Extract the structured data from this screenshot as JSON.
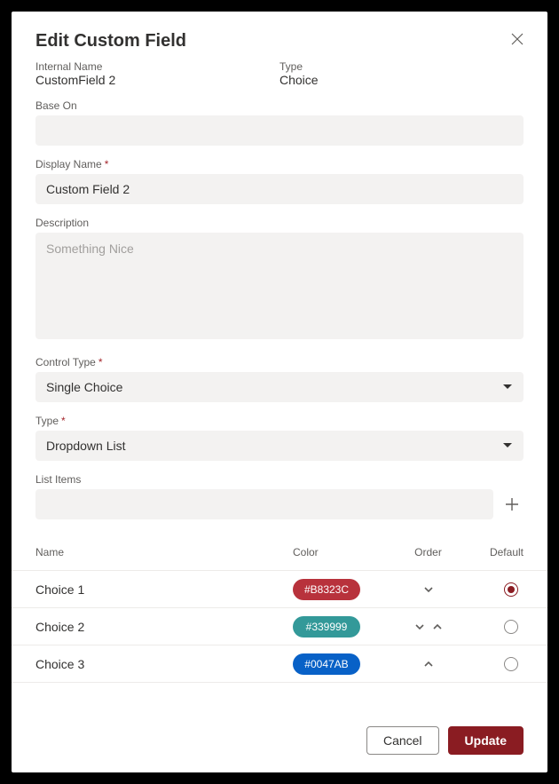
{
  "dialog": {
    "title": "Edit Custom Field"
  },
  "info": {
    "internalName": {
      "label": "Internal Name",
      "value": "CustomField 2"
    },
    "type": {
      "label": "Type",
      "value": "Choice"
    }
  },
  "fields": {
    "baseOn": {
      "label": "Base On",
      "value": ""
    },
    "displayName": {
      "label": "Display Name",
      "value": "Custom Field 2"
    },
    "description": {
      "label": "Description",
      "placeholder": "Something Nice",
      "value": ""
    },
    "controlType": {
      "label": "Control Type",
      "value": "Single Choice"
    },
    "listType": {
      "label": "Type",
      "value": "Dropdown List"
    },
    "listItems": {
      "label": "List Items",
      "value": ""
    }
  },
  "table": {
    "headers": {
      "name": "Name",
      "color": "Color",
      "order": "Order",
      "default": "Default"
    },
    "rows": [
      {
        "name": "Choice 1",
        "colorHex": "#B8323C",
        "bg": "#b8323c",
        "canUp": false,
        "canDown": true,
        "default": true
      },
      {
        "name": "Choice 2",
        "colorHex": "#339999",
        "bg": "#339999",
        "canUp": true,
        "canDown": true,
        "default": false
      },
      {
        "name": "Choice 3",
        "colorHex": "#0047AB",
        "bg": "#0861c7",
        "canUp": true,
        "canDown": false,
        "default": false
      }
    ]
  },
  "buttons": {
    "cancel": "Cancel",
    "update": "Update"
  }
}
